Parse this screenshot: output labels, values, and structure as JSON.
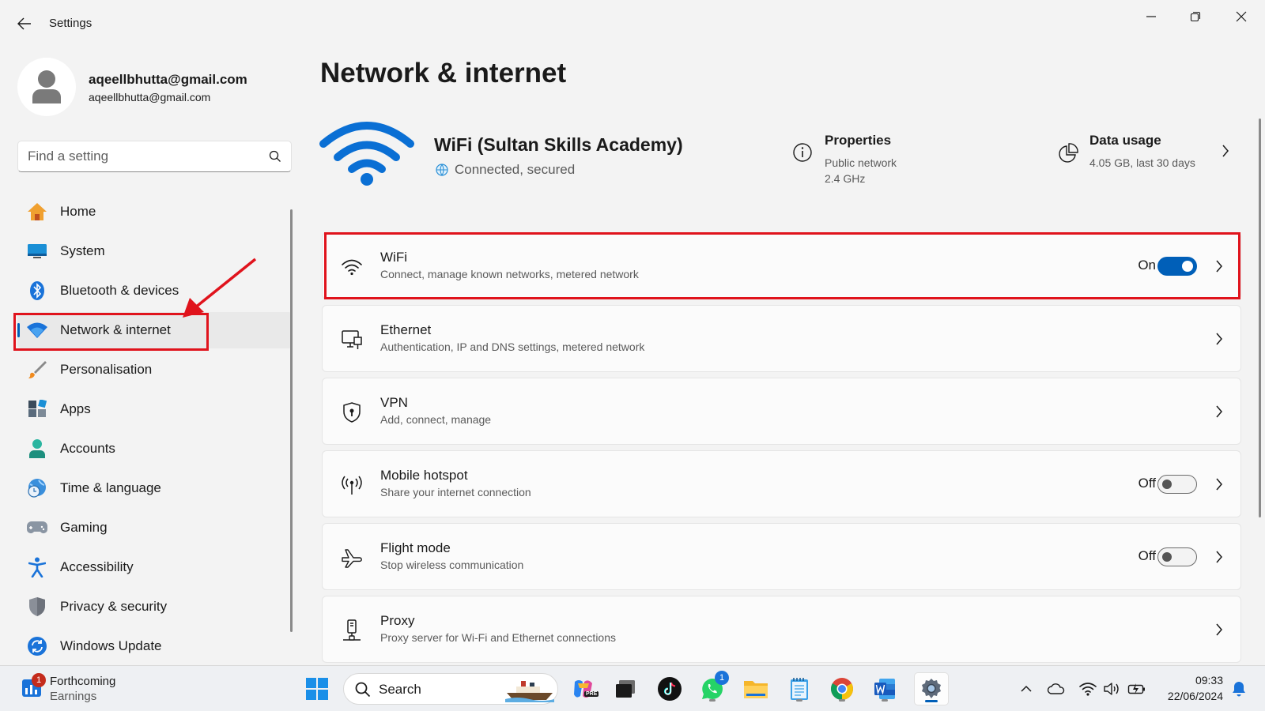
{
  "window": {
    "title": "Settings"
  },
  "profile": {
    "name": "aqeellbhutta@gmail.com",
    "email": "aqeellbhutta@gmail.com"
  },
  "search": {
    "placeholder": "Find a setting"
  },
  "nav": {
    "items": [
      {
        "label": "Home",
        "icon": "home-icon"
      },
      {
        "label": "System",
        "icon": "monitor-icon"
      },
      {
        "label": "Bluetooth & devices",
        "icon": "bluetooth-icon"
      },
      {
        "label": "Network & internet",
        "icon": "wifi-icon",
        "active": true
      },
      {
        "label": "Personalisation",
        "icon": "brush-icon"
      },
      {
        "label": "Apps",
        "icon": "apps-icon"
      },
      {
        "label": "Accounts",
        "icon": "person-icon"
      },
      {
        "label": "Time & language",
        "icon": "globe-clock-icon"
      },
      {
        "label": "Gaming",
        "icon": "gamepad-icon"
      },
      {
        "label": "Accessibility",
        "icon": "accessibility-icon"
      },
      {
        "label": "Privacy & security",
        "icon": "shield-icon"
      },
      {
        "label": "Windows Update",
        "icon": "update-icon"
      }
    ]
  },
  "main": {
    "title": "Network & internet",
    "hero": {
      "network_name": "WiFi (Sultan Skills Academy)",
      "status": "Connected, secured",
      "properties": {
        "title": "Properties",
        "line1": "Public network",
        "line2": "2.4 GHz"
      },
      "data_usage": {
        "title": "Data usage",
        "detail": "4.05 GB, last 30 days"
      }
    },
    "cards": [
      {
        "title": "WiFi",
        "subtitle": "Connect, manage known networks, metered network",
        "toggle": "On"
      },
      {
        "title": "Ethernet",
        "subtitle": "Authentication, IP and DNS settings, metered network"
      },
      {
        "title": "VPN",
        "subtitle": "Add, connect, manage"
      },
      {
        "title": "Mobile hotspot",
        "subtitle": "Share your internet connection",
        "toggle": "Off"
      },
      {
        "title": "Flight mode",
        "subtitle": "Stop wireless communication",
        "toggle": "Off"
      },
      {
        "title": "Proxy",
        "subtitle": "Proxy server for Wi-Fi and Ethernet connections"
      }
    ]
  },
  "taskbar": {
    "widget": {
      "badge": "1",
      "line1": "Forthcoming",
      "line2": "Earnings"
    },
    "search_label": "Search",
    "whatsapp_badge": "1",
    "copilot_badge": "PRE",
    "clock": {
      "time": "09:33",
      "date": "22/06/2024"
    }
  },
  "colors": {
    "accent": "#005fb8",
    "annotation": "#e0131c"
  }
}
